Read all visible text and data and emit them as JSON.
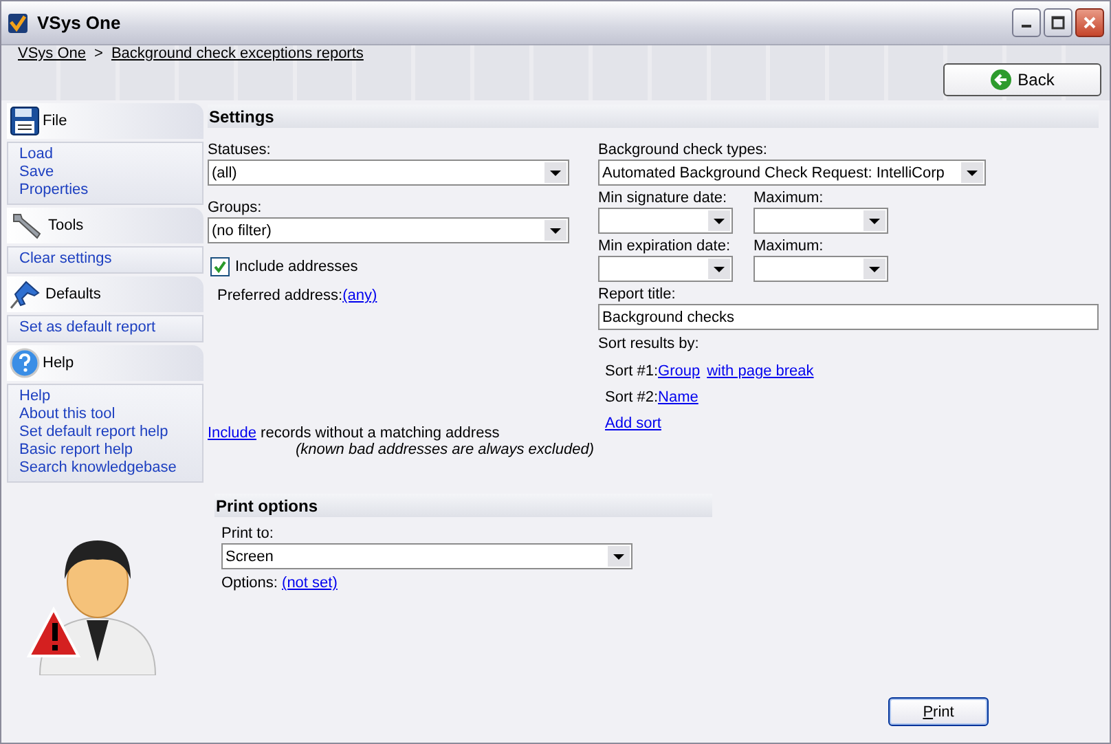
{
  "window": {
    "title": "VSys One"
  },
  "breadcrumb": {
    "items": [
      "VSys One",
      "Background check exceptions reports"
    ],
    "separator": ">"
  },
  "back_button": {
    "label": "Back"
  },
  "sidebar": [
    {
      "title": "File",
      "items": [
        "Load",
        "Save",
        "Properties"
      ]
    },
    {
      "title": "Tools",
      "items": [
        "Clear settings"
      ]
    },
    {
      "title": "Defaults",
      "items": [
        "Set as default report"
      ]
    },
    {
      "title": "Help",
      "items": [
        "Help",
        "About this tool",
        "Set default report help",
        "Basic report help",
        "Search knowledgebase"
      ]
    }
  ],
  "settings": {
    "title": "Settings",
    "statuses": {
      "label": "Statuses:",
      "value": "(all)"
    },
    "groups": {
      "label": "Groups:",
      "value": "(no filter)"
    },
    "include_addresses": {
      "label": "Include addresses",
      "checked": true
    },
    "preferred_address": {
      "label": "Preferred address:",
      "link": "(any)"
    },
    "include_records": {
      "link": "Include",
      "text": "records without a matching address",
      "note": "(known bad addresses are always excluded)"
    },
    "check_types": {
      "label": "Background check types:",
      "value": "Automated Background Check Request: IntelliCorp"
    },
    "dates": [
      {
        "label": "Min signature date:"
      },
      {
        "label": "Maximum:"
      },
      {
        "label": "Min expiration date:"
      },
      {
        "label": "Maximum:"
      }
    ],
    "report_title": {
      "label": "Report title:",
      "value": "Background checks"
    },
    "sort": {
      "label": "Sort results by:",
      "sorts": [
        {
          "label": "Sort #1:",
          "field": "Group",
          "option": "with page break"
        },
        {
          "label": "Sort #2:",
          "field": "Name"
        }
      ],
      "add": "Add sort"
    }
  },
  "print_options": {
    "title": "Print options",
    "print_to": {
      "label": "Print to:",
      "value": "Screen"
    },
    "options": {
      "label": "Options:",
      "link": "(not set)"
    }
  },
  "print_button": {
    "label": "Print"
  }
}
